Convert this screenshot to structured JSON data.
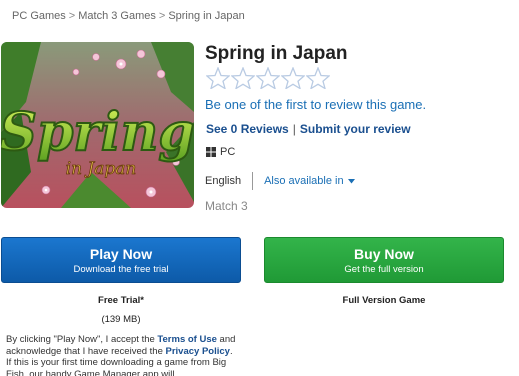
{
  "breadcrumb": {
    "items": [
      "PC Games",
      "Match 3 Games",
      "Spring in Japan"
    ],
    "separator": ">"
  },
  "game": {
    "title": "Spring in Japan",
    "hero_logo_word": "Spring",
    "hero_logo_sub": "in Japan",
    "rating_stars_filled": 0,
    "rating_stars_total": 5,
    "review_prompt": "Be one of the first to review this game.",
    "see_reviews": "See 0 Reviews",
    "submit_review": "Submit your review",
    "platform": "PC",
    "language": "English",
    "also_available": "Also available in",
    "genre": "Match 3"
  },
  "play": {
    "label": "Play Now",
    "sublabel": "Download the free trial",
    "trial_label": "Free Trial*",
    "size": "(139 MB)"
  },
  "buy": {
    "label": "Buy Now",
    "sublabel": "Get the full version",
    "full_label": "Full Version Game"
  },
  "legal": {
    "p1": "By clicking \"Play Now\", I accept the ",
    "terms": "Terms of Use",
    "p2": " and acknowledge that I have received the ",
    "privacy": "Privacy Policy",
    "p3": ". If this is your first time downloading a game from Big Fish, our handy Game Manager app will"
  },
  "colors": {
    "link": "#1a6fb5",
    "play_button": "#1b77cf",
    "buy_button": "#33b44a"
  }
}
